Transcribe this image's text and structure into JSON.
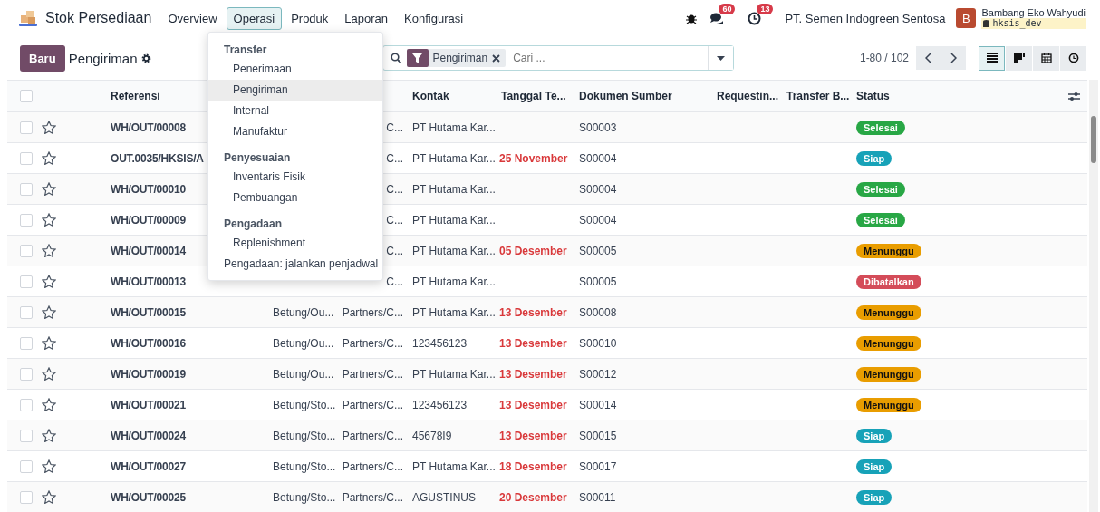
{
  "navbar": {
    "app_name": "Stok Persediaan",
    "menu": [
      {
        "label": "Overview",
        "selected": false
      },
      {
        "label": "Operasi",
        "selected": true
      },
      {
        "label": "Produk",
        "selected": false
      },
      {
        "label": "Laporan",
        "selected": false
      },
      {
        "label": "Konfigurasi",
        "selected": false
      }
    ],
    "messages_badge": "60",
    "activities_badge": "13",
    "company": "PT. Semen Indogreen Sentosa",
    "avatar_letter": "B",
    "user_name": "Bambang Eko Wahyudi",
    "database": "hksis_dev"
  },
  "dropdown": [
    {
      "kind": "header",
      "label": "Transfer"
    },
    {
      "kind": "subitem",
      "label": "Penerimaan",
      "selected": false
    },
    {
      "kind": "subitem",
      "label": "Pengiriman",
      "selected": true
    },
    {
      "kind": "subitem",
      "label": "Internal",
      "selected": false
    },
    {
      "kind": "subitem",
      "label": "Manufaktur",
      "selected": false
    },
    {
      "kind": "header",
      "label": "Penyesuaian"
    },
    {
      "kind": "subitem",
      "label": "Inventaris Fisik",
      "selected": false
    },
    {
      "kind": "subitem",
      "label": "Pembuangan",
      "selected": false
    },
    {
      "kind": "header",
      "label": "Pengadaan"
    },
    {
      "kind": "subitem",
      "label": "Replenishment",
      "selected": false
    },
    {
      "kind": "item",
      "label": "Pengadaan: jalankan penjadwal",
      "selected": false
    }
  ],
  "control_panel": {
    "new_button": "Baru",
    "title": "Pengiriman",
    "facet": "Pengiriman",
    "search_placeholder": "Cari ...",
    "pager": "1-80 / 102",
    "views": [
      {
        "kind": "list",
        "selected": true
      },
      {
        "kind": "kanban",
        "selected": false
      },
      {
        "kind": "calendar",
        "selected": false
      },
      {
        "kind": "activity",
        "selected": false
      }
    ]
  },
  "table": {
    "select_all_checked": false,
    "columns": [
      "Referensi",
      "Kontak",
      "Tanggal Te...",
      "Dokumen Sumber",
      "Requestin...",
      "Transfer B...",
      "Status"
    ],
    "rows": [
      {
        "checked": false,
        "starred": false,
        "reference": "WH/OUT/00008",
        "column_5": "C...",
        "contact": "PT Hutama Kar...",
        "source": "S00003",
        "status": {
          "label": "Selesai",
          "color": "#28a745"
        }
      },
      {
        "checked": false,
        "starred": false,
        "reference": "OUT.0035/HKSIS/A",
        "column_5": "C...",
        "contact": "PT Hutama Kar...",
        "date": "25 November",
        "source": "S00004",
        "status": {
          "label": "Siap",
          "color": "#17a2b8"
        }
      },
      {
        "checked": false,
        "starred": false,
        "reference": "WH/OUT/00010",
        "column_5": "C...",
        "contact": "PT Hutama Kar...",
        "source": "S00004",
        "status": {
          "label": "Selesai",
          "color": "#28a745"
        }
      },
      {
        "checked": false,
        "starred": false,
        "reference": "WH/OUT/00009",
        "column_5": "C...",
        "contact": "PT Hutama Kar...",
        "source": "S00004",
        "status": {
          "label": "Selesai",
          "color": "#28a745"
        }
      },
      {
        "checked": false,
        "starred": false,
        "reference": "WH/OUT/00014",
        "column_5": "C...",
        "contact": "PT Hutama Kar...",
        "date": "05 Desember",
        "source": "S00005",
        "status": {
          "label": "Menunggu",
          "color": "#e99d00"
        }
      },
      {
        "checked": false,
        "starred": false,
        "reference": "WH/OUT/00013",
        "column_5": "C...",
        "contact": "PT Hutama Kar...",
        "source": "S00005",
        "status": {
          "label": "Dibatalkan",
          "color": "#d44c59"
        }
      },
      {
        "checked": false,
        "starred": false,
        "reference": "WH/OUT/00015",
        "column_4": "Betung/Ou...",
        "column_5": "Partners/C...",
        "contact": "PT Hutama Kar...",
        "date": "13 Desember",
        "source": "S00008",
        "status": {
          "label": "Menunggu",
          "color": "#e99d00"
        }
      },
      {
        "checked": false,
        "starred": false,
        "reference": "WH/OUT/00016",
        "column_4": "Betung/Ou...",
        "column_5": "Partners/C...",
        "contact": "123456123",
        "date": "13 Desember",
        "source": "S00010",
        "status": {
          "label": "Menunggu",
          "color": "#e99d00"
        }
      },
      {
        "checked": false,
        "starred": false,
        "reference": "WH/OUT/00019",
        "column_4": "Betung/Ou...",
        "column_5": "Partners/C...",
        "contact": "PT Hutama Kar...",
        "date": "13 Desember",
        "source": "S00012",
        "status": {
          "label": "Menunggu",
          "color": "#e99d00"
        }
      },
      {
        "checked": false,
        "starred": false,
        "reference": "WH/OUT/00021",
        "column_4": "Betung/Sto...",
        "column_5": "Partners/C...",
        "contact": "123456123",
        "date": "13 Desember",
        "source": "S00014",
        "status": {
          "label": "Menunggu",
          "color": "#e99d00"
        }
      },
      {
        "checked": false,
        "starred": false,
        "reference": "WH/OUT/00024",
        "column_4": "Betung/Sto...",
        "column_5": "Partners/C...",
        "contact": "45678I9",
        "date": "13 Desember",
        "source": "S00015",
        "status": {
          "label": "Siap",
          "color": "#17a2b8"
        }
      },
      {
        "checked": false,
        "starred": false,
        "reference": "WH/OUT/00027",
        "column_4": "Betung/Sto...",
        "column_5": "Partners/C...",
        "contact": "PT Hutama Kar...",
        "date": "18 Desember",
        "source": "S00017",
        "status": {
          "label": "Siap",
          "color": "#17a2b8"
        }
      },
      {
        "checked": false,
        "starred": false,
        "reference": "WH/OUT/00025",
        "column_4": "Betung/Sto...",
        "column_5": "Partners/C...",
        "contact": "AGUSTINUS",
        "date": "20 Desember",
        "source": "S00011",
        "status": {
          "label": "Siap",
          "color": "#17a2b8"
        }
      }
    ]
  }
}
